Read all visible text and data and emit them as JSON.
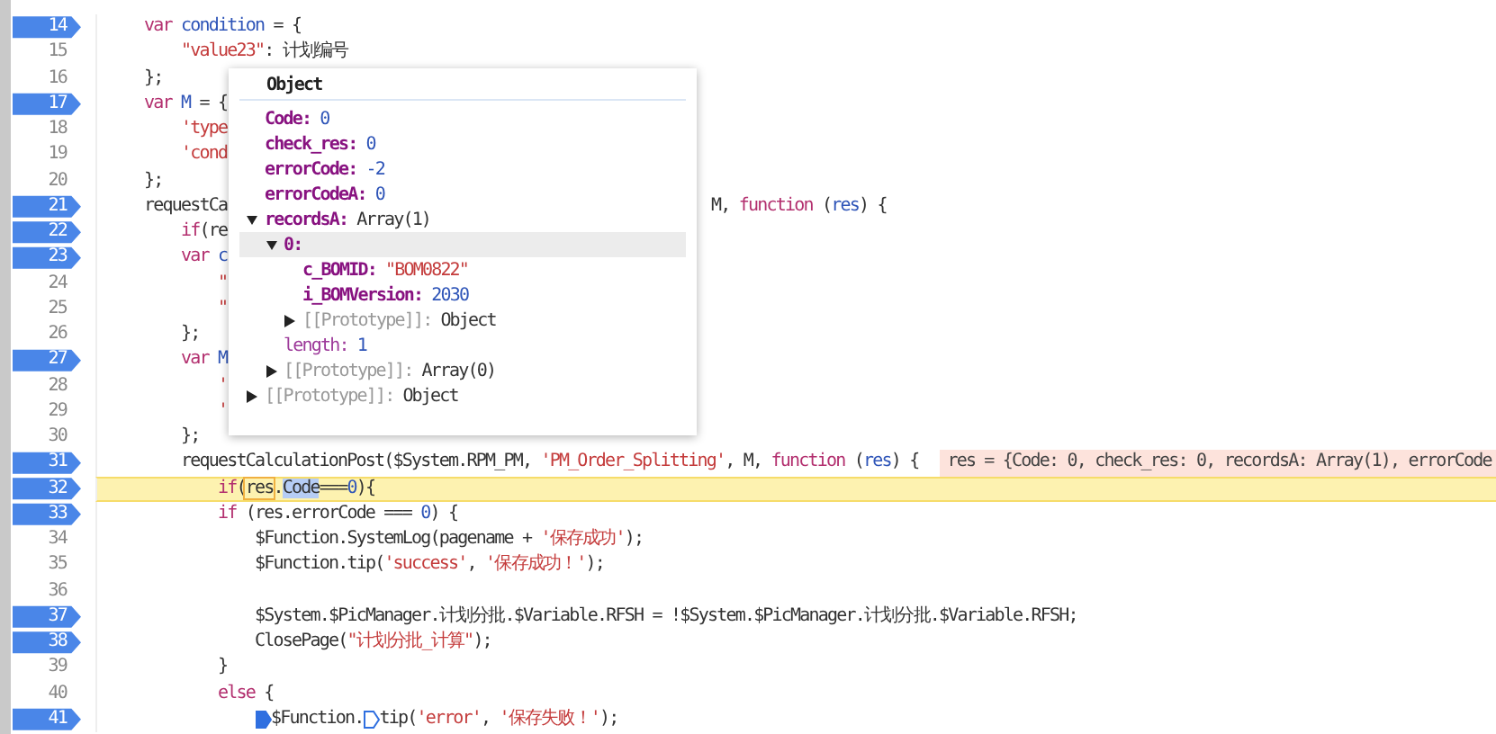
{
  "lines": [
    {
      "number": "14",
      "breakpoint": true,
      "current": false,
      "tokens": [
        {
          "kind": "kw",
          "text": "var"
        },
        {
          "kind": "def",
          "text": " condition"
        },
        {
          "kind": "plain",
          "text": " = {"
        }
      ],
      "children": [
        {
          "number": "15",
          "breakpoint": false,
          "current": false,
          "tokens": [
            {
              "kind": "str",
              "text": "\"value23\""
            },
            {
              "kind": "plain",
              "text": ": 计划编号"
            }
          ]
        }
      ]
    },
    {
      "number": "16",
      "breakpoint": false,
      "current": false,
      "tokens": [
        {
          "kind": "plain",
          "text": "};"
        }
      ]
    },
    {
      "number": "17",
      "breakpoint": true,
      "current": false,
      "tokens": [
        {
          "kind": "kw",
          "text": "var"
        },
        {
          "kind": "def",
          "text": " M"
        },
        {
          "kind": "plain",
          "text": " = {"
        }
      ],
      "children": [
        {
          "number": "18",
          "breakpoint": false,
          "current": false,
          "tokens": [
            {
              "kind": "str",
              "text": "'type"
            }
          ]
        },
        {
          "number": "19",
          "breakpoint": false,
          "current": false,
          "tokens": [
            {
              "kind": "str",
              "text": "'cond"
            }
          ]
        }
      ]
    },
    {
      "number": "20",
      "breakpoint": false,
      "current": false,
      "tokens": [
        {
          "kind": "plain",
          "text": "};"
        }
      ]
    },
    {
      "number": "21",
      "breakpoint": true,
      "current": false,
      "tokens": [
        {
          "kind": "plain",
          "text": "requestCa"
        }
      ],
      "tail": [
        {
          "kind": "plain",
          "text": "M, "
        },
        {
          "kind": "kw",
          "text": "function"
        },
        {
          "kind": "plain",
          "text": " ("
        },
        {
          "kind": "def",
          "text": "res"
        },
        {
          "kind": "plain",
          "text": ") {"
        }
      ],
      "children": [
        {
          "number": "22",
          "breakpoint": true,
          "current": false,
          "tokens": [
            {
              "kind": "kw",
              "text": "if"
            },
            {
              "kind": "plain",
              "text": "(re"
            }
          ]
        },
        {
          "number": "23",
          "breakpoint": true,
          "current": false,
          "tokens": [
            {
              "kind": "kw",
              "text": "var"
            },
            {
              "kind": "def",
              "text": " c"
            }
          ],
          "children": [
            {
              "number": "24",
              "breakpoint": false,
              "current": false,
              "tokens": [
                {
                  "kind": "str",
                  "text": "\""
                }
              ]
            },
            {
              "number": "25",
              "breakpoint": false,
              "current": false,
              "tokens": [
                {
                  "kind": "str",
                  "text": "\""
                }
              ]
            }
          ]
        },
        {
          "number": "26",
          "breakpoint": false,
          "current": false,
          "tokens": [
            {
              "kind": "plain",
              "text": "};"
            }
          ]
        },
        {
          "number": "27",
          "breakpoint": true,
          "current": false,
          "tokens": [
            {
              "kind": "kw",
              "text": "var"
            },
            {
              "kind": "def",
              "text": " M"
            }
          ],
          "children": [
            {
              "number": "28",
              "breakpoint": false,
              "current": false,
              "tokens": [
                {
                  "kind": "str",
                  "text": "'"
                }
              ]
            },
            {
              "number": "29",
              "breakpoint": false,
              "current": false,
              "tokens": [
                {
                  "kind": "str",
                  "text": "'"
                }
              ]
            }
          ]
        },
        {
          "number": "30",
          "breakpoint": false,
          "current": false,
          "tokens": [
            {
              "kind": "plain",
              "text": "};"
            }
          ]
        },
        {
          "number": "31",
          "breakpoint": true,
          "current": false,
          "tokens": [
            {
              "kind": "plain",
              "text": "requestCalculationPost($System.RPM_PM, "
            },
            {
              "kind": "str",
              "text": "'PM_Order_Splitting'"
            },
            {
              "kind": "plain",
              "text": ", M, "
            },
            {
              "kind": "kw",
              "text": "function"
            },
            {
              "kind": "plain",
              "text": " ("
            },
            {
              "kind": "def",
              "text": "res"
            },
            {
              "kind": "plain",
              "text": ") {"
            }
          ],
          "inline_value": "res = {Code: 0, check_res: 0, recordsA: Array(1), errorCode",
          "children": [
            {
              "number": "32",
              "breakpoint": true,
              "current": true,
              "tokens": [
                {
                  "kind": "kw",
                  "text": "if"
                },
                {
                  "kind": "plain",
                  "text": "("
                },
                {
                  "kind": "hover",
                  "text": "res"
                },
                {
                  "kind": "plain",
                  "text": "."
                },
                {
                  "kind": "selection",
                  "text": "Code"
                },
                {
                  "kind": "plain",
                  "text": "==="
                },
                {
                  "kind": "num",
                  "text": "0"
                },
                {
                  "kind": "plain",
                  "text": "){"
                }
              ]
            },
            {
              "number": "33",
              "breakpoint": true,
              "current": false,
              "tokens": [
                {
                  "kind": "kw",
                  "text": "if"
                },
                {
                  "kind": "plain",
                  "text": " (res.errorCode === "
                },
                {
                  "kind": "num",
                  "text": "0"
                },
                {
                  "kind": "plain",
                  "text": ") {"
                }
              ],
              "children": [
                {
                  "number": "34",
                  "breakpoint": false,
                  "current": false,
                  "tokens": [
                    {
                      "kind": "plain",
                      "text": "$Function.SystemLog(pagename + "
                    },
                    {
                      "kind": "str",
                      "text": "'保存成功'"
                    },
                    {
                      "kind": "plain",
                      "text": ");"
                    }
                  ]
                },
                {
                  "number": "35",
                  "breakpoint": false,
                  "current": false,
                  "tokens": [
                    {
                      "kind": "plain",
                      "text": "$Function.tip("
                    },
                    {
                      "kind": "str",
                      "text": "'success'"
                    },
                    {
                      "kind": "plain",
                      "text": ", "
                    },
                    {
                      "kind": "str",
                      "text": "'保存成功！'"
                    },
                    {
                      "kind": "plain",
                      "text": ");"
                    }
                  ]
                },
                {
                  "number": "36",
                  "breakpoint": false,
                  "current": false
                },
                {
                  "number": "37",
                  "breakpoint": true,
                  "current": false,
                  "tokens": [
                    {
                      "kind": "plain",
                      "text": "$System.$PicManager.计划分批.$Variable.RFSH = !$System.$PicManager.计划分批.$Variable.RFSH;"
                    }
                  ]
                },
                {
                  "number": "38",
                  "breakpoint": true,
                  "current": false,
                  "tokens": [
                    {
                      "kind": "plain",
                      "text": "ClosePage("
                    },
                    {
                      "kind": "str",
                      "text": "\"计划分批_计算\""
                    },
                    {
                      "kind": "plain",
                      "text": ");"
                    }
                  ]
                }
              ]
            },
            {
              "number": "39",
              "breakpoint": false,
              "current": false,
              "tokens": [
                {
                  "kind": "plain",
                  "text": "}"
                }
              ]
            },
            {
              "number": "40",
              "breakpoint": false,
              "current": false,
              "tokens": [
                {
                  "kind": "kw",
                  "text": "else"
                },
                {
                  "kind": "plain",
                  "text": " {"
                }
              ],
              "children": [
                {
                  "number": "41",
                  "breakpoint": true,
                  "current": false,
                  "tokens": [
                    {
                      "kind": "marker",
                      "active": true
                    },
                    {
                      "kind": "plain",
                      "text": "$Function."
                    },
                    {
                      "kind": "marker",
                      "active": false
                    },
                    {
                      "kind": "plain",
                      "text": "tip("
                    },
                    {
                      "kind": "str",
                      "text": "'error'"
                    },
                    {
                      "kind": "plain",
                      "text": ", "
                    },
                    {
                      "kind": "str",
                      "text": "'保存失败！'"
                    },
                    {
                      "kind": "plain",
                      "text": ");"
                    }
                  ]
                }
              ]
            }
          ]
        }
      ]
    }
  ],
  "popup": {
    "title": "Object",
    "entries": [
      {
        "kind": "own",
        "key": "Code:",
        "value": {
          "kind": "number",
          "text": "0"
        },
        "highlighted": false
      },
      {
        "kind": "own",
        "key": "check_res:",
        "value": {
          "kind": "number",
          "text": "0"
        },
        "highlighted": false
      },
      {
        "kind": "own",
        "key": "errorCode:",
        "value": {
          "kind": "number",
          "text": "-2"
        },
        "highlighted": false
      },
      {
        "kind": "own",
        "key": "errorCodeA:",
        "value": {
          "kind": "number",
          "text": "0"
        },
        "highlighted": false
      },
      {
        "kind": "own",
        "key": "recordsA:",
        "value": {
          "kind": "object",
          "text": "Array(1)"
        },
        "highlighted": false,
        "expanded": true,
        "children": [
          {
            "kind": "own",
            "key": "0:",
            "highlighted": true,
            "expanded": true,
            "children": [
              {
                "kind": "own",
                "key": "c_BOMID:",
                "value": {
                  "kind": "string",
                  "text": "\"BOM0822\""
                },
                "highlighted": false
              },
              {
                "kind": "own",
                "key": "i_BOMVersion:",
                "value": {
                  "kind": "number",
                  "text": "2030"
                },
                "highlighted": false
              },
              {
                "kind": "internal",
                "key": "[[Prototype]]:",
                "value": {
                  "kind": "object",
                  "text": "Object"
                },
                "highlighted": false,
                "expanded": false
              }
            ]
          },
          {
            "kind": "inherited",
            "key": "length:",
            "value": {
              "kind": "number",
              "text": "1"
            },
            "highlighted": false
          },
          {
            "kind": "internal",
            "key": "[[Prototype]]:",
            "value": {
              "kind": "object",
              "text": "Array(0)"
            },
            "highlighted": false,
            "expanded": false
          }
        ]
      },
      {
        "kind": "internal",
        "key": "[[Prototype]]:",
        "value": {
          "kind": "object",
          "text": "Object"
        },
        "highlighted": false,
        "expanded": false
      }
    ]
  }
}
